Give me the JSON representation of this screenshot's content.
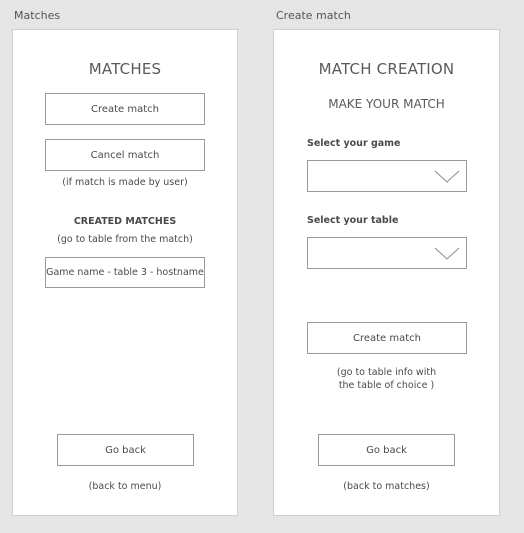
{
  "frames": {
    "matches_label": "Matches",
    "create_match_label": "Create match"
  },
  "matches": {
    "title": "MATCHES",
    "create_button": "Create match",
    "cancel_button": "Cancel match",
    "cancel_note": "(if match is made by user)",
    "created_heading": "CREATED MATCHES",
    "created_note": "(go to table from the match)",
    "match_item": "Game name - table 3 - hostname",
    "back_button": "Go back",
    "back_note": "(back to menu)"
  },
  "creation": {
    "title": "MATCH CREATION",
    "subtitle": "MAKE YOUR MATCH",
    "game_label": "Select your game",
    "table_label": "Select your table",
    "game_value": "",
    "table_value": "",
    "create_button": "Create match",
    "create_note_line1": "(go to table info with",
    "create_note_line2": "the table of choice )",
    "back_button": "Go back",
    "back_note": "(back to matches)"
  },
  "icons": {
    "dropdown": "chevron-down-icon"
  }
}
